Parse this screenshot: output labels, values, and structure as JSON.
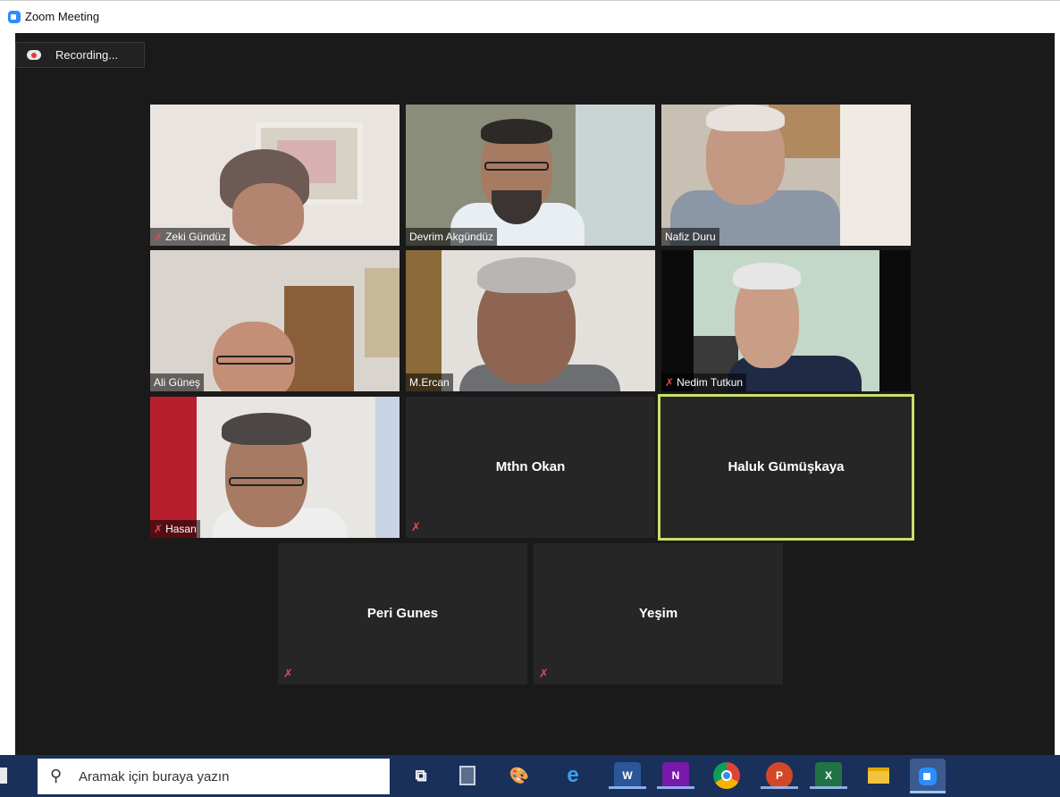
{
  "window": {
    "title": "Zoom Meeting"
  },
  "recording": {
    "label": "Recording..."
  },
  "participants": [
    {
      "name": "Zeki Gündüz",
      "muted": true,
      "video": true
    },
    {
      "name": "Devrim Akgündüz",
      "muted": false,
      "video": true
    },
    {
      "name": "Nafiz Duru",
      "muted": false,
      "video": true
    },
    {
      "name": "Ali Güneş",
      "muted": false,
      "video": true
    },
    {
      "name": "M.Ercan",
      "muted": false,
      "video": true
    },
    {
      "name": "Nedim Tutkun",
      "muted": true,
      "video": true
    },
    {
      "name": "Hasan",
      "muted": true,
      "video": true
    },
    {
      "name": "Mthn Okan",
      "muted": true,
      "video": false
    },
    {
      "name": "Haluk Gümüşkaya",
      "muted": false,
      "video": false,
      "active_speaker": true
    },
    {
      "name": "Peri Gunes",
      "muted": true,
      "video": false
    },
    {
      "name": "Yeşim",
      "muted": true,
      "video": false
    }
  ],
  "taskbar": {
    "search_placeholder": "Aramak için buraya yazın",
    "apps": [
      "task-view",
      "calculator",
      "paint",
      "edge",
      "word",
      "onenote",
      "chrome",
      "powerpoint",
      "excel",
      "file-explorer",
      "zoom"
    ]
  },
  "colors": {
    "meeting_bg": "#1a1a1a",
    "tile_bg": "#262626",
    "active_border": "#c9e06a",
    "mute_red": "#e5484d",
    "taskbar": "#19305a"
  }
}
